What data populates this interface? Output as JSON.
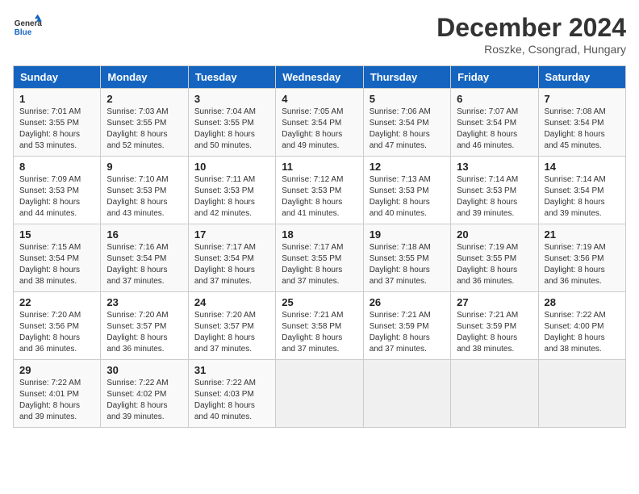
{
  "header": {
    "logo_line1": "General",
    "logo_line2": "Blue",
    "month": "December 2024",
    "location": "Roszke, Csongrad, Hungary"
  },
  "weekdays": [
    "Sunday",
    "Monday",
    "Tuesday",
    "Wednesday",
    "Thursday",
    "Friday",
    "Saturday"
  ],
  "weeks": [
    [
      {
        "day": "1",
        "sunrise": "7:01 AM",
        "sunset": "3:55 PM",
        "daylight": "8 hours and 53 minutes."
      },
      {
        "day": "2",
        "sunrise": "7:03 AM",
        "sunset": "3:55 PM",
        "daylight": "8 hours and 52 minutes."
      },
      {
        "day": "3",
        "sunrise": "7:04 AM",
        "sunset": "3:55 PM",
        "daylight": "8 hours and 50 minutes."
      },
      {
        "day": "4",
        "sunrise": "7:05 AM",
        "sunset": "3:54 PM",
        "daylight": "8 hours and 49 minutes."
      },
      {
        "day": "5",
        "sunrise": "7:06 AM",
        "sunset": "3:54 PM",
        "daylight": "8 hours and 47 minutes."
      },
      {
        "day": "6",
        "sunrise": "7:07 AM",
        "sunset": "3:54 PM",
        "daylight": "8 hours and 46 minutes."
      },
      {
        "day": "7",
        "sunrise": "7:08 AM",
        "sunset": "3:54 PM",
        "daylight": "8 hours and 45 minutes."
      }
    ],
    [
      {
        "day": "8",
        "sunrise": "7:09 AM",
        "sunset": "3:53 PM",
        "daylight": "8 hours and 44 minutes."
      },
      {
        "day": "9",
        "sunrise": "7:10 AM",
        "sunset": "3:53 PM",
        "daylight": "8 hours and 43 minutes."
      },
      {
        "day": "10",
        "sunrise": "7:11 AM",
        "sunset": "3:53 PM",
        "daylight": "8 hours and 42 minutes."
      },
      {
        "day": "11",
        "sunrise": "7:12 AM",
        "sunset": "3:53 PM",
        "daylight": "8 hours and 41 minutes."
      },
      {
        "day": "12",
        "sunrise": "7:13 AM",
        "sunset": "3:53 PM",
        "daylight": "8 hours and 40 minutes."
      },
      {
        "day": "13",
        "sunrise": "7:14 AM",
        "sunset": "3:53 PM",
        "daylight": "8 hours and 39 minutes."
      },
      {
        "day": "14",
        "sunrise": "7:14 AM",
        "sunset": "3:54 PM",
        "daylight": "8 hours and 39 minutes."
      }
    ],
    [
      {
        "day": "15",
        "sunrise": "7:15 AM",
        "sunset": "3:54 PM",
        "daylight": "8 hours and 38 minutes."
      },
      {
        "day": "16",
        "sunrise": "7:16 AM",
        "sunset": "3:54 PM",
        "daylight": "8 hours and 37 minutes."
      },
      {
        "day": "17",
        "sunrise": "7:17 AM",
        "sunset": "3:54 PM",
        "daylight": "8 hours and 37 minutes."
      },
      {
        "day": "18",
        "sunrise": "7:17 AM",
        "sunset": "3:55 PM",
        "daylight": "8 hours and 37 minutes."
      },
      {
        "day": "19",
        "sunrise": "7:18 AM",
        "sunset": "3:55 PM",
        "daylight": "8 hours and 37 minutes."
      },
      {
        "day": "20",
        "sunrise": "7:19 AM",
        "sunset": "3:55 PM",
        "daylight": "8 hours and 36 minutes."
      },
      {
        "day": "21",
        "sunrise": "7:19 AM",
        "sunset": "3:56 PM",
        "daylight": "8 hours and 36 minutes."
      }
    ],
    [
      {
        "day": "22",
        "sunrise": "7:20 AM",
        "sunset": "3:56 PM",
        "daylight": "8 hours and 36 minutes."
      },
      {
        "day": "23",
        "sunrise": "7:20 AM",
        "sunset": "3:57 PM",
        "daylight": "8 hours and 36 minutes."
      },
      {
        "day": "24",
        "sunrise": "7:20 AM",
        "sunset": "3:57 PM",
        "daylight": "8 hours and 37 minutes."
      },
      {
        "day": "25",
        "sunrise": "7:21 AM",
        "sunset": "3:58 PM",
        "daylight": "8 hours and 37 minutes."
      },
      {
        "day": "26",
        "sunrise": "7:21 AM",
        "sunset": "3:59 PM",
        "daylight": "8 hours and 37 minutes."
      },
      {
        "day": "27",
        "sunrise": "7:21 AM",
        "sunset": "3:59 PM",
        "daylight": "8 hours and 38 minutes."
      },
      {
        "day": "28",
        "sunrise": "7:22 AM",
        "sunset": "4:00 PM",
        "daylight": "8 hours and 38 minutes."
      }
    ],
    [
      {
        "day": "29",
        "sunrise": "7:22 AM",
        "sunset": "4:01 PM",
        "daylight": "8 hours and 39 minutes."
      },
      {
        "day": "30",
        "sunrise": "7:22 AM",
        "sunset": "4:02 PM",
        "daylight": "8 hours and 39 minutes."
      },
      {
        "day": "31",
        "sunrise": "7:22 AM",
        "sunset": "4:03 PM",
        "daylight": "8 hours and 40 minutes."
      },
      null,
      null,
      null,
      null
    ]
  ]
}
